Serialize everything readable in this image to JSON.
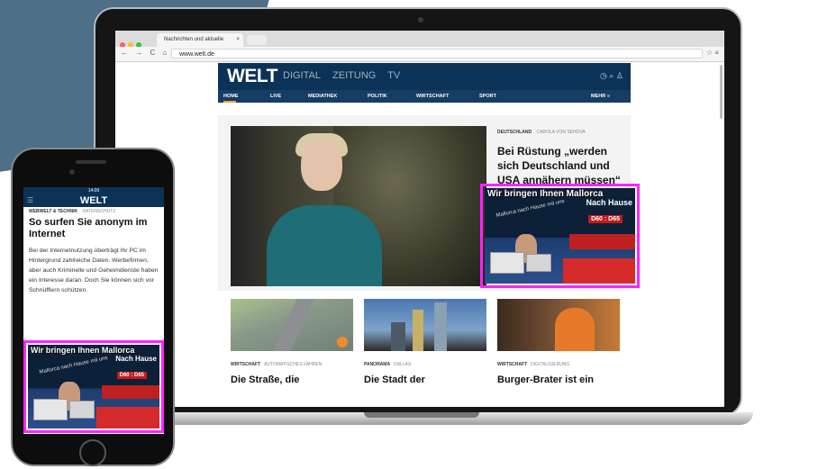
{
  "browser": {
    "tab_title": "Nachrichten und aktuelle",
    "tab_close": "×",
    "nav_symbols": "← → C ⌂",
    "url": "www.welt.de",
    "bookmark_icons": "☆ ≡"
  },
  "welt": {
    "logo": "WELT",
    "sections": [
      "DIGITAL",
      "ZEITUNG",
      "TV"
    ],
    "header_icons": "◷  ⌕  ♙",
    "nav": [
      "HOME",
      "LIVE",
      "MEDIATHEK",
      "POLITIK",
      "WIRTSCHAFT",
      "SPORT"
    ],
    "nav_more": "MEHR ≡",
    "hero": {
      "kicker": "DEUTSCHLAND",
      "kicker_sub": "CAROLA VON SEHOVA",
      "headline": "Bei Rüstung „werden sich Deutschland und USA annähern müssen“"
    },
    "cards": [
      {
        "kicker": "WIRTSCHAFT",
        "kicker_sub": "AUTOMATISCHES FAHREN",
        "title": "Die Straße, die"
      },
      {
        "kicker": "PANORAMA",
        "kicker_sub": "DALLAS",
        "title": "Die Stadt der"
      },
      {
        "kicker": "WIRTSCHAFT",
        "kicker_sub": "DIGITALISIERUNG",
        "title": "Burger-Brater ist ein"
      }
    ]
  },
  "ad": {
    "line1": "Wir bringen Ihnen Mallorca",
    "line2": "Nach Hause",
    "line3": "Mallorca nach Hause mit uns",
    "price": "D60 : D65"
  },
  "phone": {
    "status_time": "14:00",
    "logo": "WELT",
    "menu_icon": "☰",
    "kicker": "WEBWELT & TECHNIK",
    "kicker_sub": "DATENSCHUTZ",
    "title": "So surfen Sie anonym im Internet",
    "body": "Bei der Internetnutzung überträgt Ihr PC im Hintergrund zahlreiche Daten. Werbefirmen, aber auch Kriminelle und Geheimdienste haben ein Interesse daran. Doch Sie können sich vor Schnüfflern schützen."
  },
  "colors": {
    "welt_navy": "#0b3257",
    "ad_highlight": "#ff22ff",
    "accent": "#f0a43a",
    "background_shape": "#4d6f88"
  }
}
